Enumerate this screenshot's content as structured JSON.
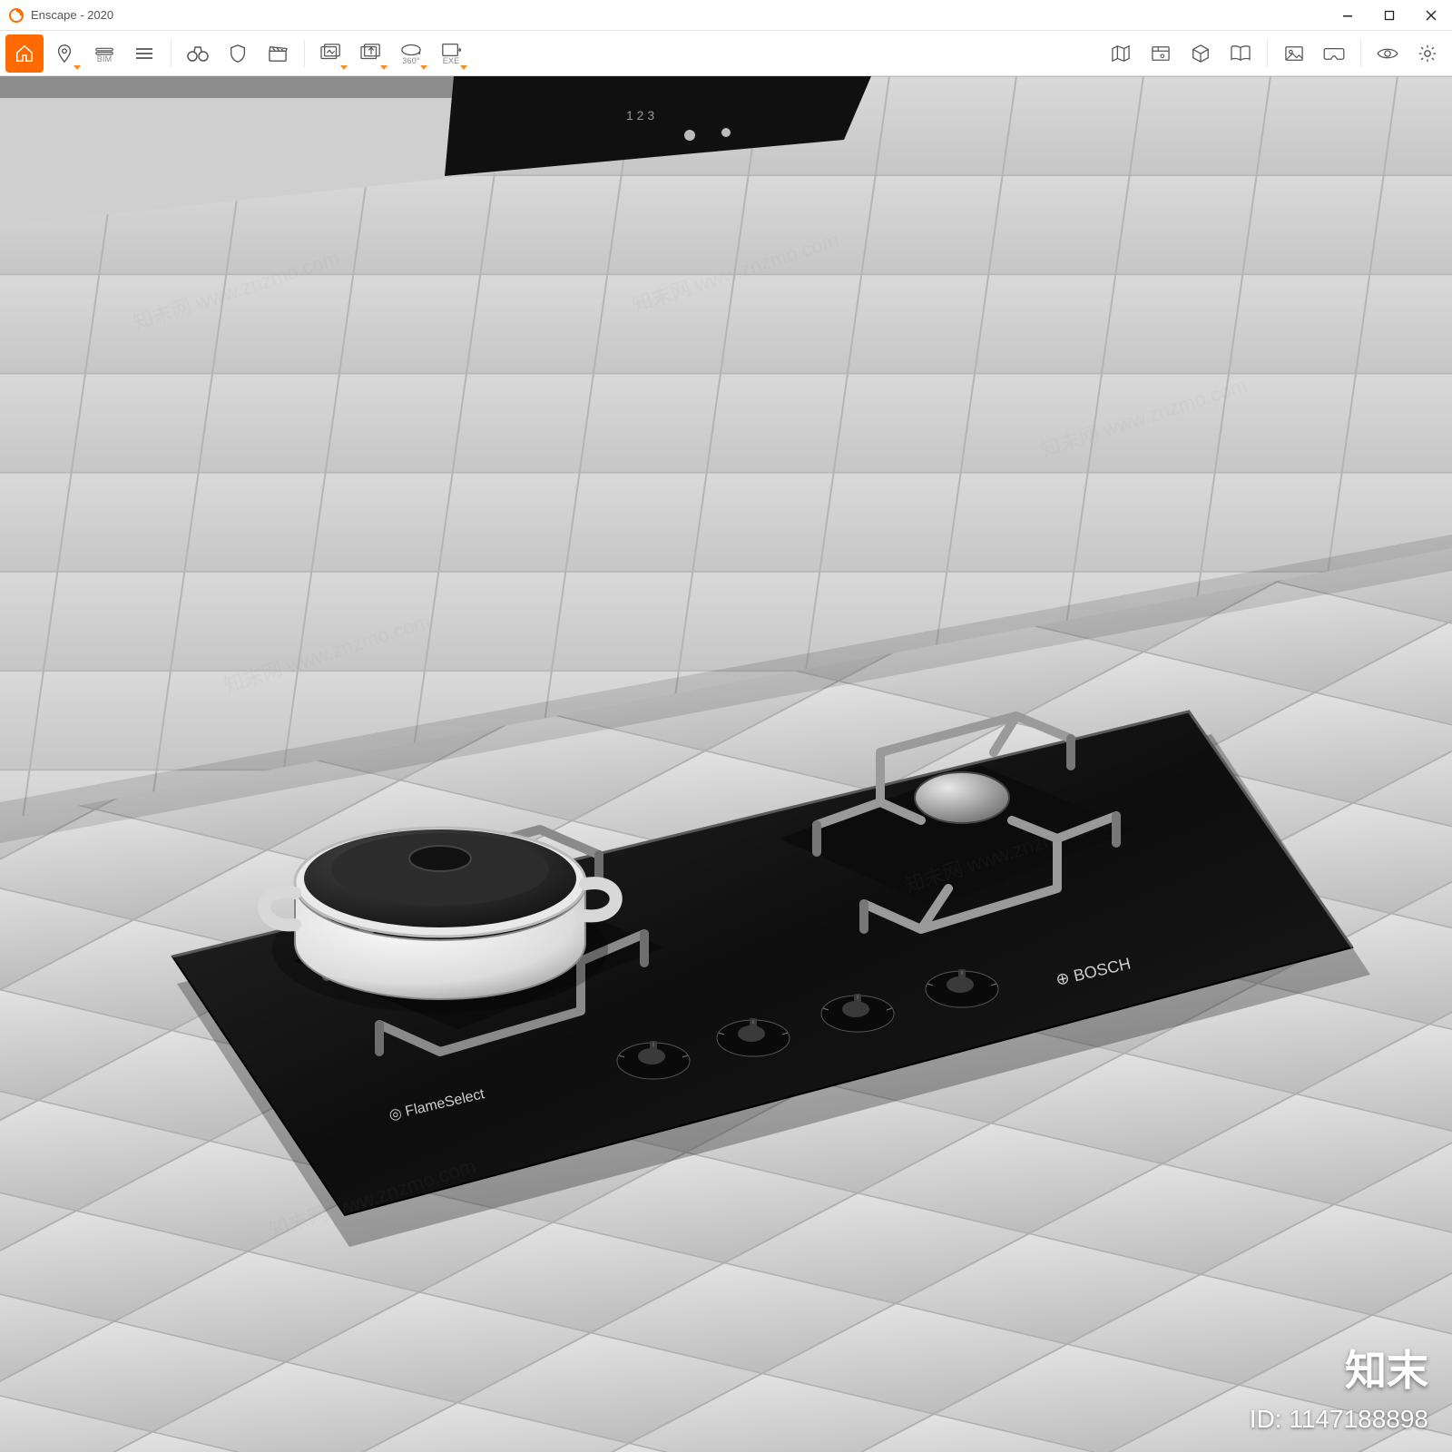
{
  "window": {
    "title": "Enscape - 2020"
  },
  "toolbar_left": {
    "home_label": "",
    "bim_label": "BIM",
    "pano_label": "360°",
    "exe_label": "EXE"
  },
  "overlay": {
    "brand": "知末",
    "id_label": "ID: 1147188898"
  },
  "icons": {
    "home": "home-icon",
    "pin": "map-pin-icon",
    "bim": "bim-icon",
    "menu": "hamburger-icon",
    "binoculars": "binoculars-icon",
    "shield": "shield-icon",
    "clapper": "clapperboard-icon",
    "batch1": "batch-render-icon",
    "batch2": "batch-upload-icon",
    "pano360": "pano-360-icon",
    "exportExe": "export-exe-icon",
    "map": "map-icon",
    "assets": "asset-library-icon",
    "cube": "cube-icon",
    "book": "open-book-icon",
    "image": "image-icon",
    "vr": "vr-headset-icon",
    "eye": "eye-icon",
    "gear": "gear-icon"
  }
}
